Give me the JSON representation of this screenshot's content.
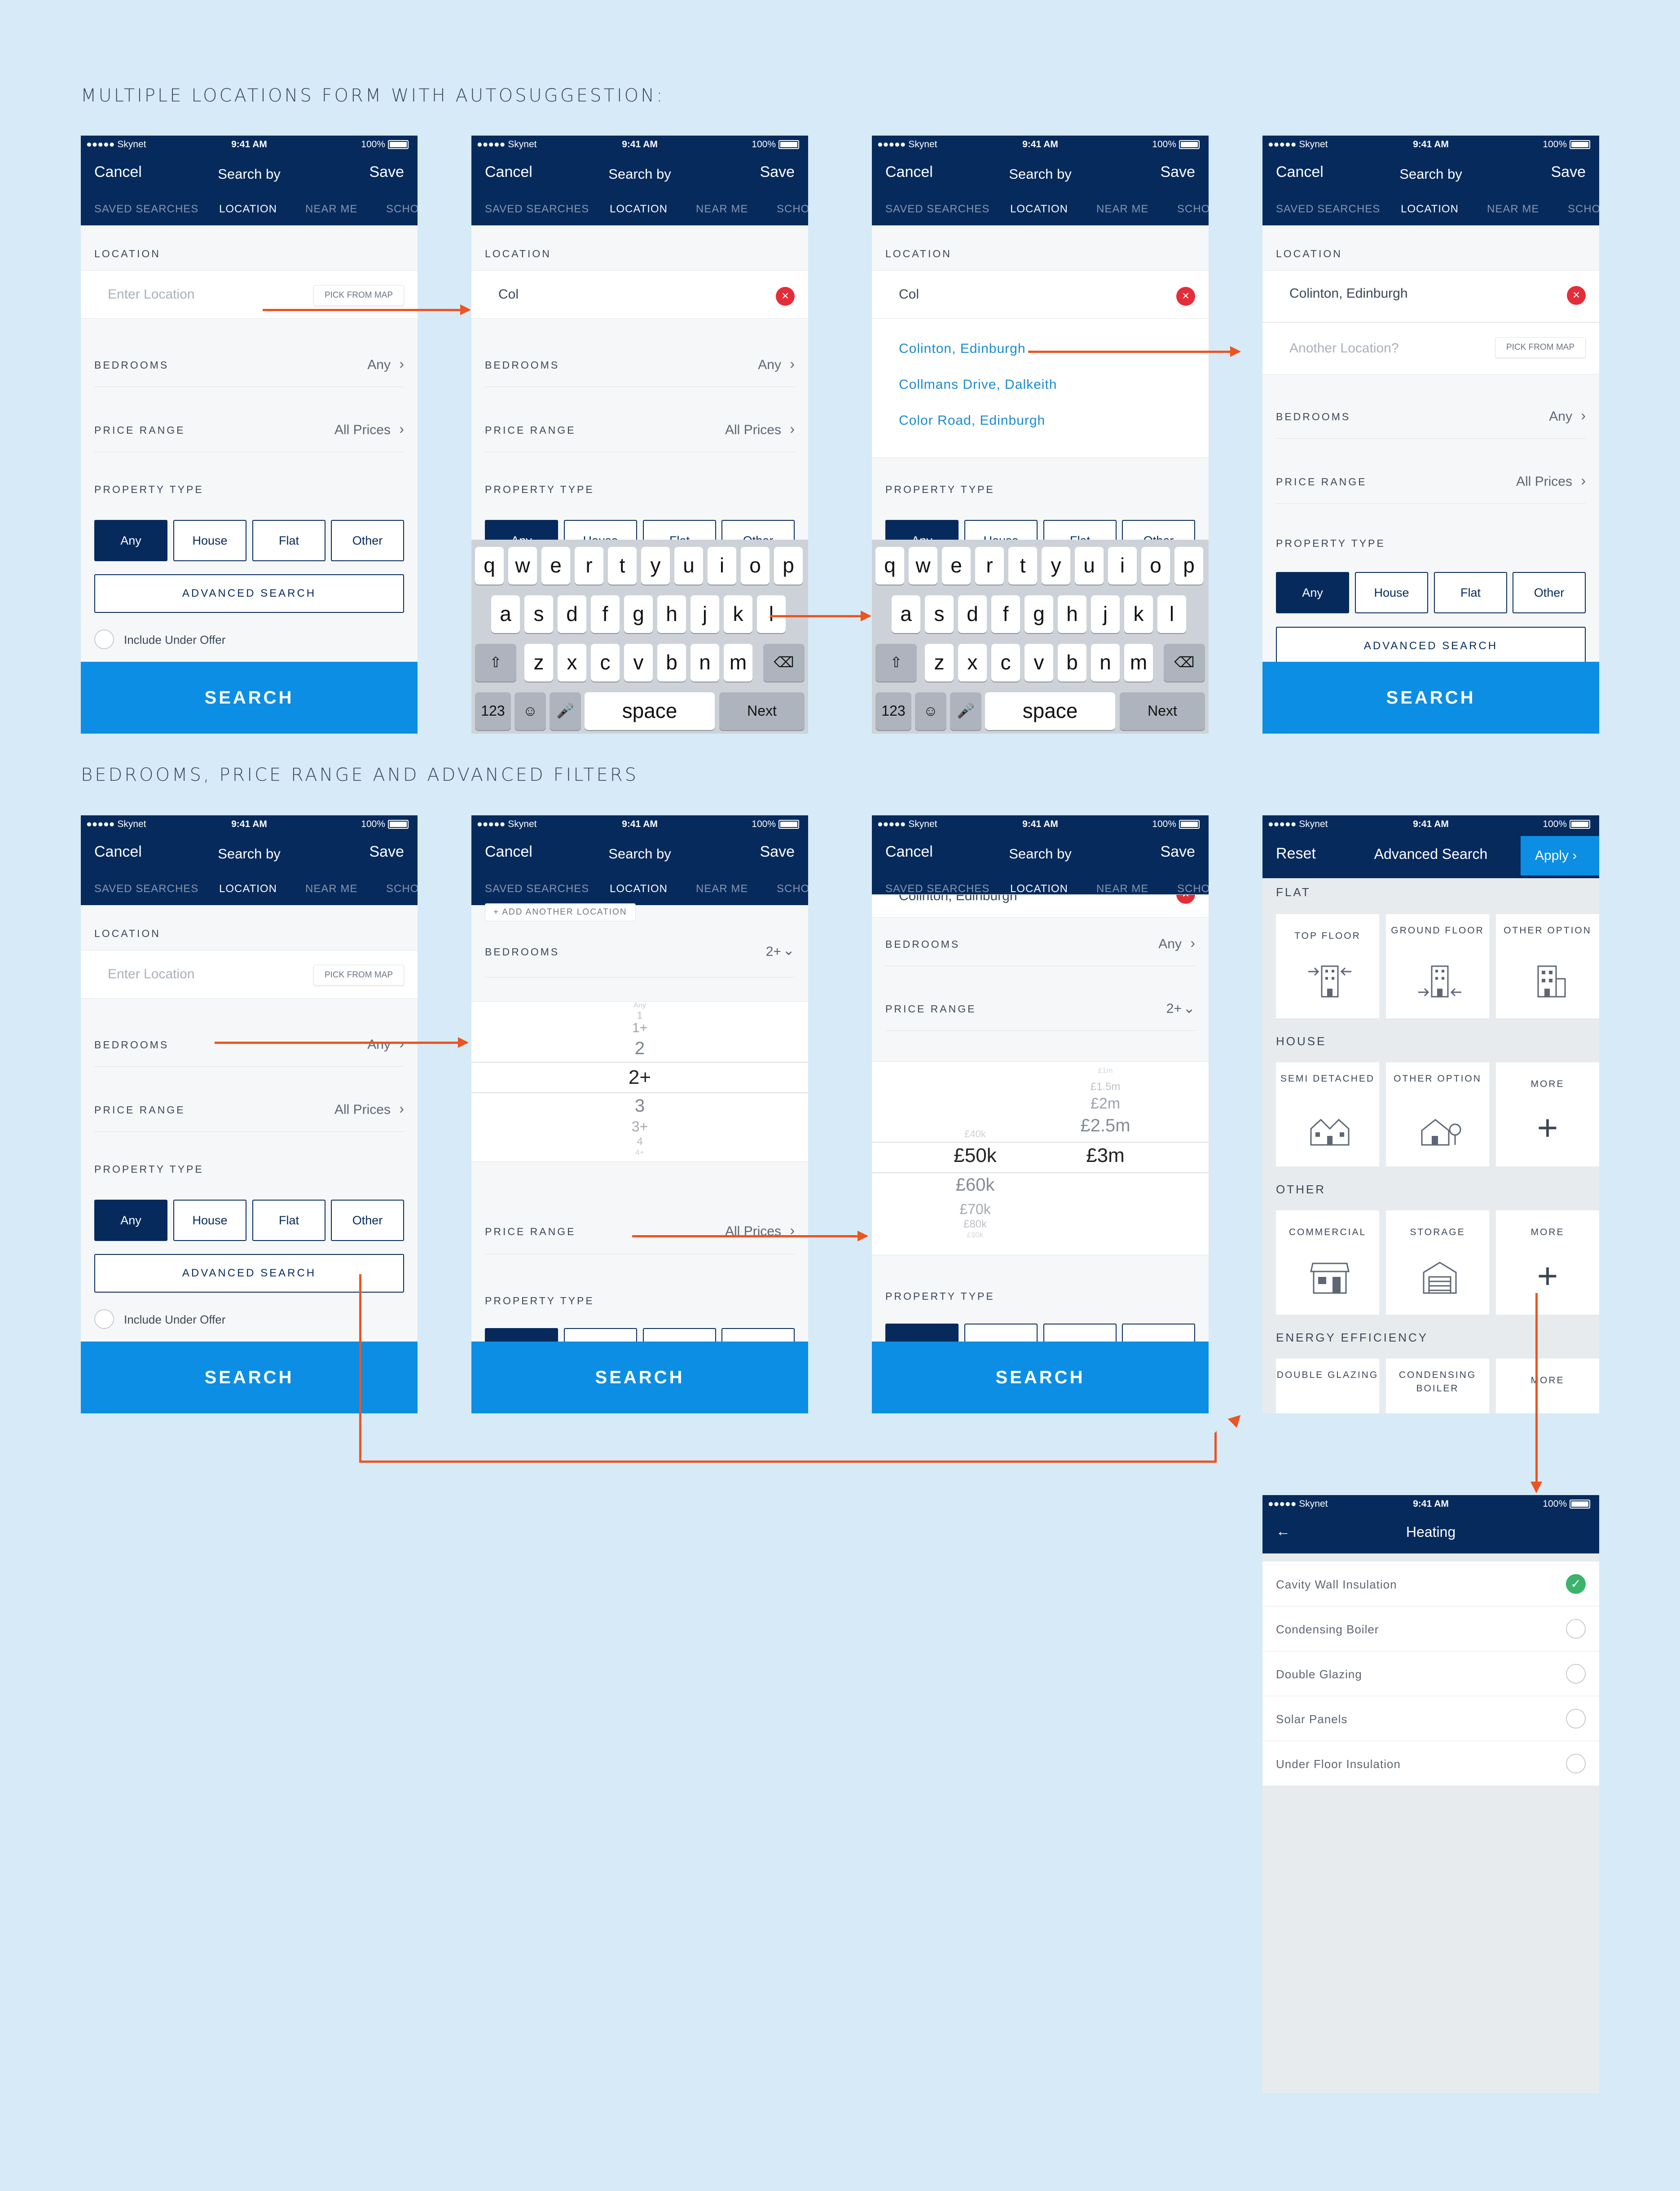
{
  "sections": {
    "top": "MULTIPLE LOCATIONS FORM WITH AUTOSUGGESTION:",
    "bottom": "BEDROOMS, PRICE RANGE AND ADVANCED FILTERS"
  },
  "status_bar": {
    "carrier": "●●●●● Skynet",
    "time": "9:41 AM",
    "battery": "100%"
  },
  "nav": {
    "cancel": "Cancel",
    "title": "Search by",
    "save": "Save"
  },
  "tabs": [
    "SAVED SEARCHES",
    "LOCATION",
    "NEAR ME",
    "SCHO"
  ],
  "form": {
    "location_label": "LOCATION",
    "location_placeholder": "Enter Location",
    "another_placeholder": "Another Location?",
    "typed_value": "Col",
    "selected_location": "Colinton, Edinburgh",
    "pick_from_map": "PICK FROM MAP",
    "bedrooms_label": "BEDROOMS",
    "bedrooms_value": "Any",
    "bedrooms_selected": "2+",
    "price_label": "PRICE RANGE",
    "price_value": "All Prices",
    "price_selected": "2+",
    "property_type_label": "PROPERTY TYPE",
    "property_types": [
      "Any",
      "House",
      "Flat",
      "Other"
    ],
    "advanced_search": "ADVANCED SEARCH",
    "include_under_offer": "Include Under Offer",
    "search_button": "SEARCH",
    "add_another_location": "+ ADD ANOTHER LOCATION",
    "partial_location": "Colinton, Edinburgh"
  },
  "suggestions": [
    "Colinton, Edinburgh",
    "Collmans Drive, Dalkeith",
    "Color Road, Edinburgh"
  ],
  "keyboard": {
    "row1": [
      "q",
      "w",
      "e",
      "r",
      "t",
      "y",
      "u",
      "i",
      "o",
      "p"
    ],
    "row2": [
      "a",
      "s",
      "d",
      "f",
      "g",
      "h",
      "j",
      "k",
      "l"
    ],
    "row3": [
      "z",
      "x",
      "c",
      "v",
      "b",
      "n",
      "m"
    ],
    "numbers": "123",
    "space": "space",
    "next": "Next"
  },
  "bedroom_picker": [
    "Any",
    "1",
    "1+",
    "2",
    "2+",
    "3",
    "3+",
    "4",
    "4+"
  ],
  "price_picker": {
    "min": [
      "£40k",
      "£50k",
      "£60k",
      "£70k",
      "£80k",
      "£90k"
    ],
    "max": [
      "£1m",
      "£1.5m",
      "£2m",
      "£2.5m",
      "£3m"
    ]
  },
  "advanced": {
    "reset": "Reset",
    "title": "Advanced Search",
    "apply": "Apply",
    "categories": [
      {
        "name": "FLAT",
        "items": [
          "TOP FLOOR",
          "GROUND FLOOR",
          "OTHER OPTION"
        ]
      },
      {
        "name": "HOUSE",
        "items": [
          "SEMI DETACHED",
          "OTHER OPTION",
          "MORE"
        ]
      },
      {
        "name": "OTHER",
        "items": [
          "COMMERCIAL",
          "STORAGE",
          "MORE"
        ]
      },
      {
        "name": "ENERGY EFFICIENCY",
        "items": [
          "DOUBLE GLAZING",
          "CONDENSING BOILER",
          "MORE"
        ]
      }
    ]
  },
  "heating": {
    "title": "Heating",
    "options": [
      {
        "label": "Cavity Wall Insulation",
        "checked": true
      },
      {
        "label": "Condensing Boiler",
        "checked": false
      },
      {
        "label": "Double Glazing",
        "checked": false
      },
      {
        "label": "Solar Panels",
        "checked": false
      },
      {
        "label": "Under Floor Insulation",
        "checked": false
      }
    ]
  },
  "colors": {
    "navy": "#062a5c",
    "blue": "#0b8ee4",
    "arrow": "#ec5420",
    "background": "#d6eaf7",
    "link": "#1c8ad0",
    "error": "#e52d39",
    "check": "#3bb36b"
  }
}
